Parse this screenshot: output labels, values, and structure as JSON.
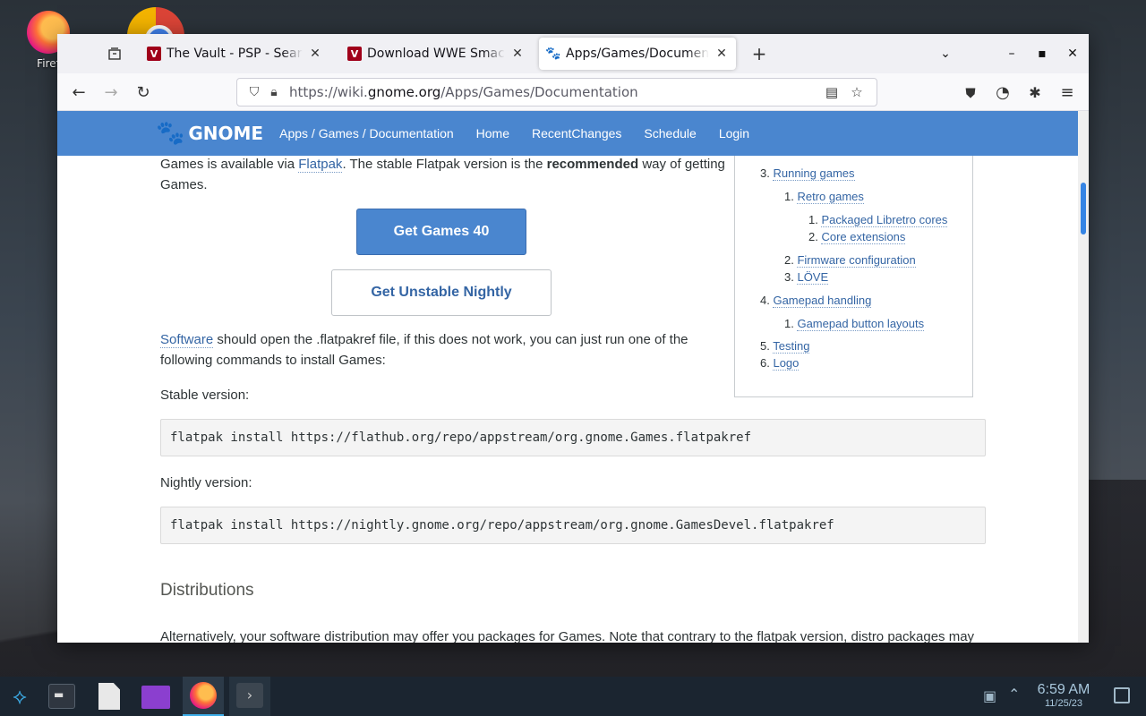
{
  "desktop": {
    "firefox_label": "Firef"
  },
  "browser": {
    "tabs": [
      {
        "title": "The Vault - PSP - Search R",
        "favicon": "vault-icon"
      },
      {
        "title": "Download WWE SmackDo",
        "favicon": "vault-icon"
      },
      {
        "title": "Apps/Games/Documentation",
        "favicon": "gnome-foot-icon",
        "active": true
      }
    ],
    "url_prefix": "https://wiki.",
    "url_domain": "gnome.org",
    "url_path": "/Apps/Games/Documentation"
  },
  "header": {
    "logo_text": "GNOME",
    "breadcrumb": "Apps / Games / Documentation",
    "links": [
      "Home",
      "RecentChanges",
      "Schedule",
      "Login"
    ]
  },
  "content": {
    "p1_a": "Games is available via ",
    "p1_link": "Flatpak",
    "p1_b": ". The stable Flatpak version is the ",
    "p1_strong": "recommended",
    "p1_c": " way of getting Games.",
    "btn_stable": "Get Games 40",
    "btn_nightly": "Get Unstable Nightly",
    "p2_link": "Software",
    "p2_text": " should open the .flatpakref file, if this does not work, you can just run one of the following commands to install Games:",
    "stable_label": "Stable version:",
    "stable_cmd": "flatpak install https://flathub.org/repo/appstream/org.gnome.Games.flatpakref",
    "nightly_label": "Nightly version:",
    "nightly_cmd": "flatpak install https://nightly.gnome.org/repo/appstream/org.gnome.GamesDevel.flatpakref",
    "distributions_heading": "Distributions",
    "p5": "Alternatively, your software distribution may offer you packages for Games. Note that contrary to the flatpak version, distro packages may"
  },
  "toc": {
    "items": [
      {
        "num": "3.",
        "label": "Running games"
      },
      {
        "num": "1.",
        "label": "Retro games"
      },
      {
        "num": "1.",
        "label": "Packaged Libretro cores"
      },
      {
        "num": "2.",
        "label": "Core extensions"
      },
      {
        "num": "2.",
        "label": "Firmware configuration"
      },
      {
        "num": "3.",
        "label": "LÖVE"
      },
      {
        "num": "4.",
        "label": "Gamepad handling"
      },
      {
        "num": "1.",
        "label": "Gamepad button layouts"
      },
      {
        "num": "5.",
        "label": "Testing"
      },
      {
        "num": "6.",
        "label": "Logo"
      }
    ]
  },
  "taskbar": {
    "time": "6:59 AM",
    "date": "11/25/23"
  },
  "colors": {
    "gnome_blue": "#4a86cf",
    "link": "#3465a4",
    "taskbar": "#1b2530"
  }
}
